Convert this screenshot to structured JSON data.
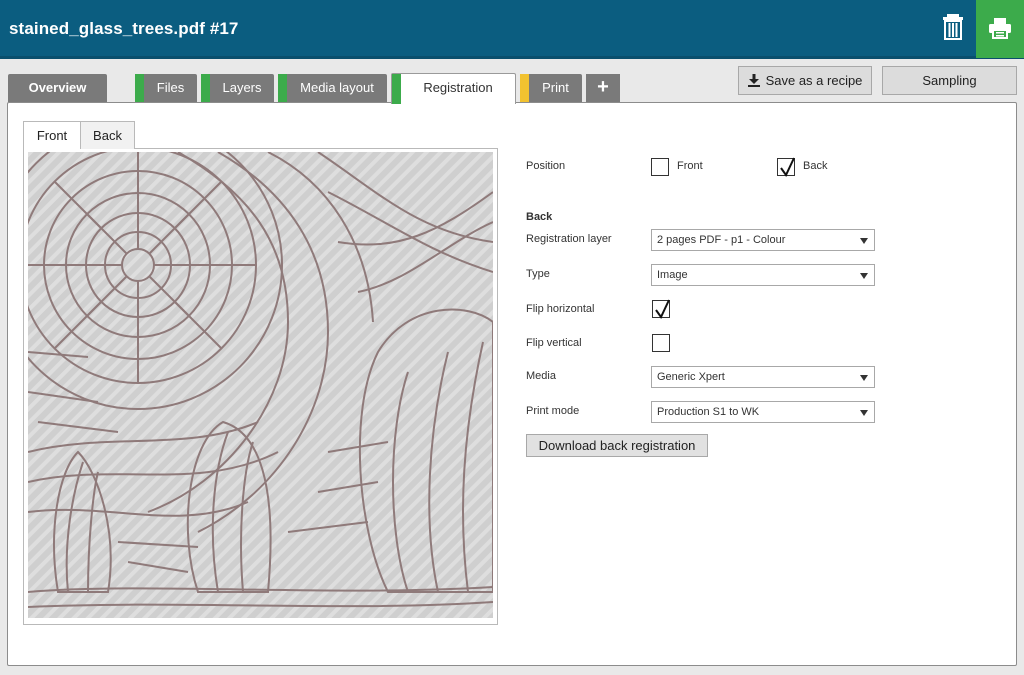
{
  "header": {
    "title": "stained_glass_trees.pdf #17",
    "accent_color": "#0b5d80",
    "print_color": "#3cab4b"
  },
  "tabs": [
    {
      "label": "Overview",
      "stripe": ""
    },
    {
      "label": "Files",
      "stripe": "#3cab4b"
    },
    {
      "label": "Layers",
      "stripe": "#3cab4b"
    },
    {
      "label": "Media layout",
      "stripe": "#3cab4b"
    },
    {
      "label": "Registration",
      "stripe": "#3cab4b",
      "active": true
    },
    {
      "label": "Print",
      "stripe": "#f2c230"
    }
  ],
  "add_tab_label": "+",
  "toolbar": {
    "save_recipe_label": "Save as a recipe",
    "sampling_label": "Sampling"
  },
  "preview": {
    "tabs": [
      "Front",
      "Back"
    ],
    "active_tab": "Front"
  },
  "form": {
    "position_label": "Position",
    "front_label": "Front",
    "back_label": "Back",
    "front_checked": false,
    "back_checked": true,
    "section_title": "Back",
    "registration_layer_label": "Registration layer",
    "registration_layer_value": "2 pages PDF - p1 - Colour",
    "type_label": "Type",
    "type_value": "Image",
    "flip_horizontal_label": "Flip horizontal",
    "flip_horizontal_checked": true,
    "flip_vertical_label": "Flip vertical",
    "flip_vertical_checked": false,
    "media_label": "Media",
    "media_value": "Generic Xpert",
    "print_mode_label": "Print mode",
    "print_mode_value": "Production S1 to WK",
    "download_button_label": "Download back registration"
  }
}
